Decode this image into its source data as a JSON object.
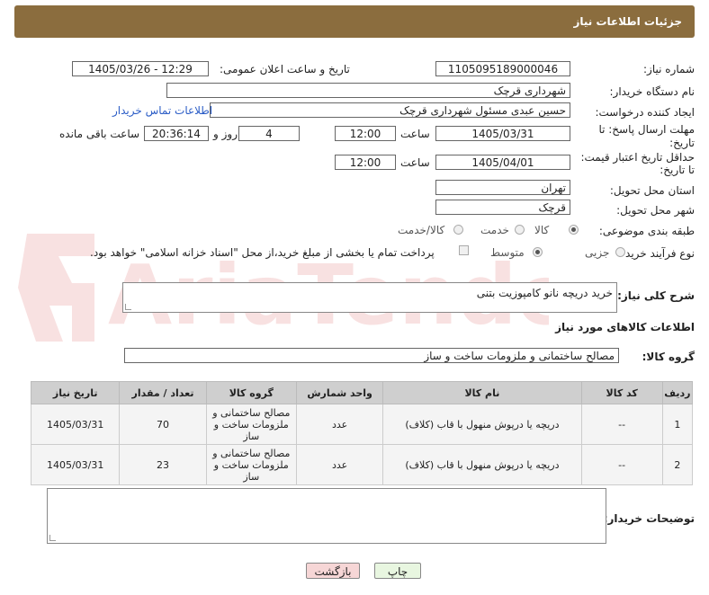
{
  "header": {
    "title": "جزئیات اطلاعات نیاز"
  },
  "fields": {
    "need_number_label": "شماره نیاز:",
    "need_number": "1105095189000046",
    "announce_label": "تاریخ و ساعت اعلان عمومی:",
    "announce_value": "1405/03/26 - 12:29",
    "buyer_org_label": "نام دستگاه خریدار:",
    "buyer_org": "شهرداری قرچک",
    "creator_label": "ایجاد کننده درخواست:",
    "creator": "حسین عبدی مسئول شهرداری قرچک",
    "buyer_contact_link": "اطلاعات تماس خریدار",
    "deadline_label_1": "مهلت ارسال پاسخ: تا",
    "deadline_label_2": "تاریخ:",
    "deadline_date": "1405/03/31",
    "hour_label": "ساعت",
    "deadline_time": "12:00",
    "days_value": "4",
    "day_label": "روز و",
    "remaining_time": "20:36:14",
    "remaining_label": "ساعت باقی مانده",
    "validity_label_1": "حداقل تاریخ اعتبار قیمت:",
    "validity_label_2": "تا تاریخ:",
    "validity_date": "1405/04/01",
    "validity_hour_label": "ساعت",
    "validity_time": "12:00",
    "province_label": "استان محل تحویل:",
    "province": "تهران",
    "city_label": "شهر محل تحویل:",
    "city": "قرچک",
    "category_label": "طبقه بندی موضوعی:",
    "category_options": [
      "کالا",
      "خدمت",
      "کالا/خدمت"
    ],
    "process_label": "نوع فرآیند خرید :",
    "process_options": [
      "جزیی",
      "متوسط"
    ],
    "payment_note": "پرداخت تمام یا بخشی از مبلغ خرید،از محل \"اسناد خزانه اسلامی\" خواهد بود.",
    "description_label": "شرح کلی نیاز:",
    "description": "خرید دریچه نانو کامپوزیت بتنی",
    "goods_info_title": "اطلاعات کالاهای مورد نیاز",
    "goods_group_label": "گروه کالا:",
    "goods_group": "مصالح ساختمانی و ملزومات ساخت و ساز",
    "buyer_notes_label": "توضیحات خریدار:"
  },
  "table": {
    "headers": [
      "ردیف",
      "کد کالا",
      "نام کالا",
      "واحد شمارش",
      "گروه کالا",
      "تعداد / مقدار",
      "تاریخ نیاز"
    ],
    "rows": [
      [
        "1",
        "--",
        "دریچه یا درپوش منهول با قاب (کلاف)",
        "عدد",
        "مصالح ساختمانی و ملزومات ساخت و ساز",
        "70",
        "1405/03/31"
      ],
      [
        "2",
        "--",
        "دریچه یا درپوش منهول با قاب (کلاف)",
        "عدد",
        "مصالح ساختمانی و ملزومات ساخت و ساز",
        "23",
        "1405/03/31"
      ]
    ]
  },
  "buttons": {
    "print": "چاپ",
    "back": "بازگشت"
  },
  "watermark": {
    "text": "AriaTender.net"
  },
  "colors": {
    "header_bg": "#8b6d3e",
    "link": "#2a5cc6",
    "back_btn": "#f6d6d6",
    "print_btn": "#e8f6e0"
  }
}
